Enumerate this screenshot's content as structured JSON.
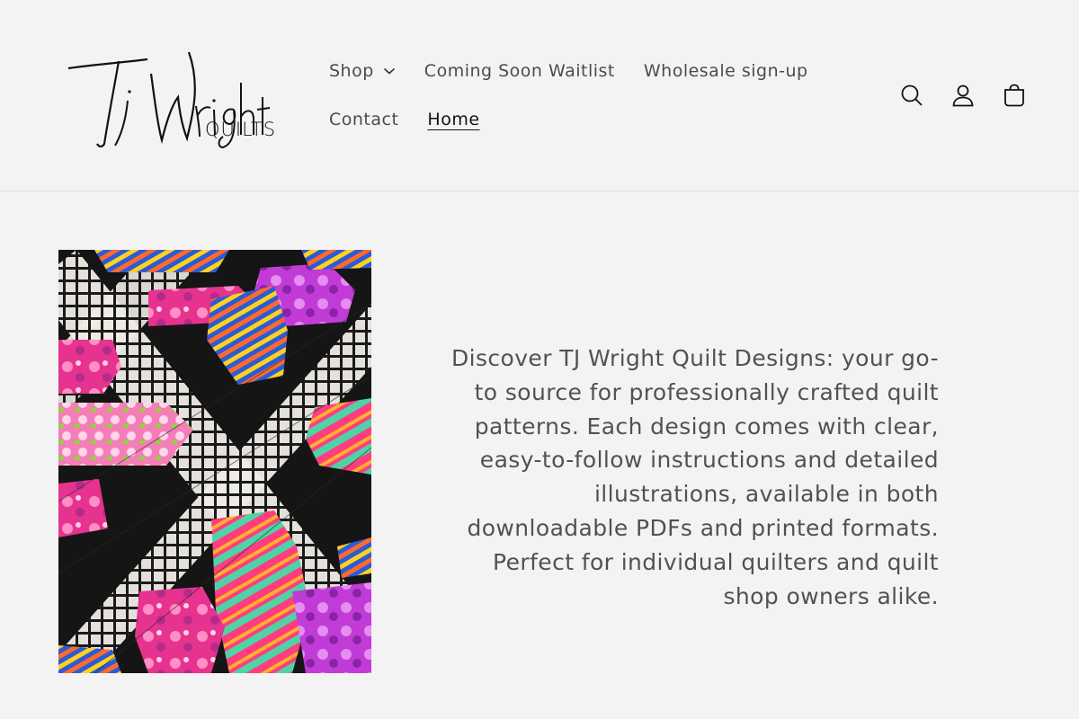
{
  "brand": {
    "logo_alt": "TJ Wright Quilts",
    "logo_script": "Tj Wright",
    "logo_sub": "QUILTS"
  },
  "nav": {
    "items": [
      {
        "label": "Shop",
        "has_dropdown": true
      },
      {
        "label": "Coming Soon Waitlist"
      },
      {
        "label": "Wholesale sign-up"
      },
      {
        "label": "Contact"
      },
      {
        "label": "Home",
        "active": true
      }
    ]
  },
  "header_icons": [
    "search-icon",
    "account-icon",
    "cart-icon"
  ],
  "hero": {
    "image_alt": "Colorful quilt with plaid strips on black background",
    "description": "Discover TJ Wright Quilt Designs: your go-to source for professionally crafted quilt patterns. Each design comes with clear, easy-to-follow instructions and detailed illustrations, available in both downloadable PDFs and printed formats. Perfect for individual quilters and quilt shop owners alike."
  },
  "colors": {
    "background": "#f3f3f3",
    "text": "#121212",
    "divider": "#dddddd"
  }
}
